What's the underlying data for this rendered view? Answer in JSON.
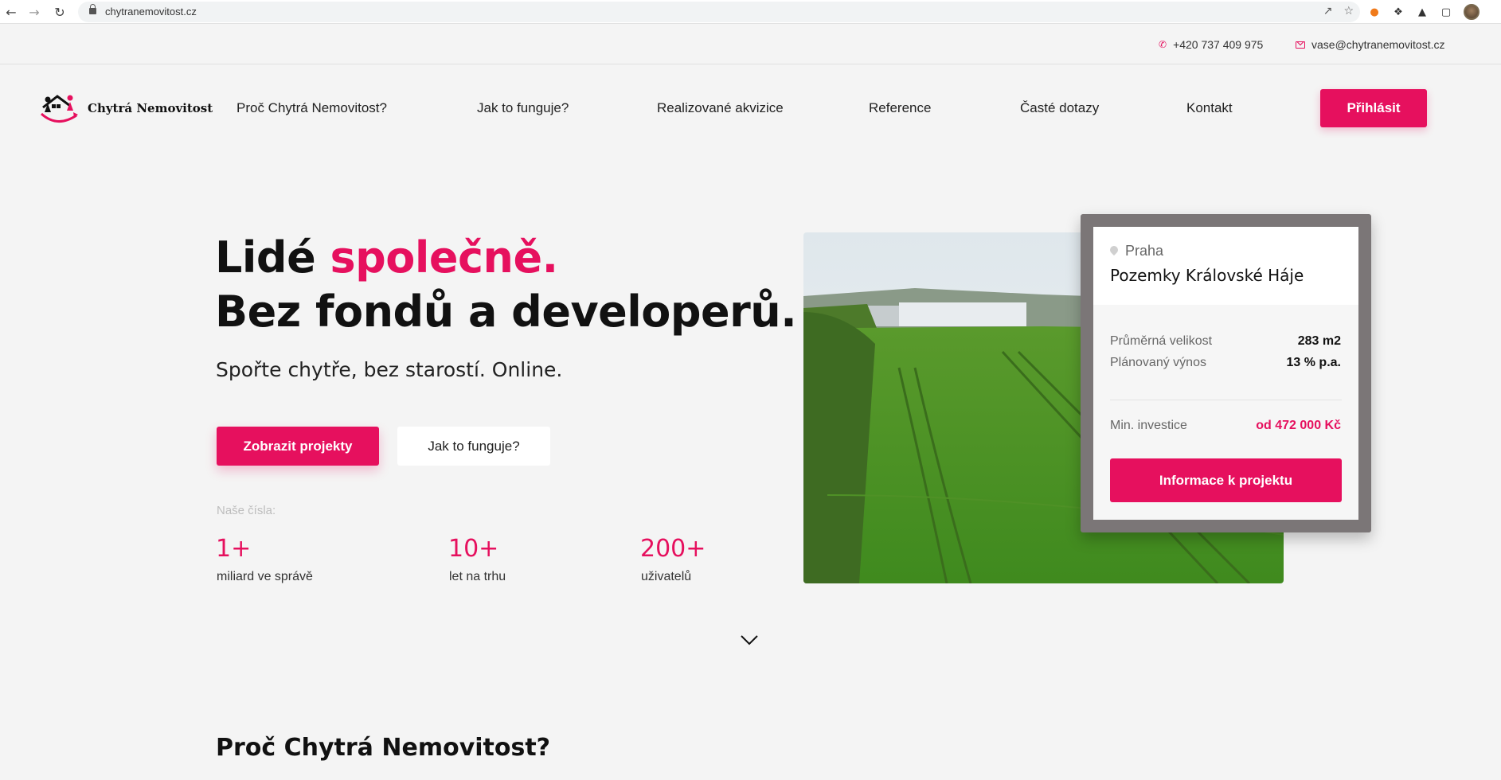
{
  "browser": {
    "url": "chytranemovitost.cz"
  },
  "contact": {
    "phone": "+420 737 409 975",
    "email": "vase@chytranemovitost.cz"
  },
  "header": {
    "logo_text": "Chytrá Nemovitost",
    "nav": [
      "Proč Chytrá Nemovitost?",
      "Jak to funguje?",
      "Realizované akvizice",
      "Reference",
      "Časté dotazy",
      "Kontakt"
    ],
    "login_label": "Přihlásit"
  },
  "hero": {
    "title_part1": "Lidé ",
    "title_highlight": "společně.",
    "title_line2": "Bez fondů a developerů.",
    "subtitle": "Spořte chytře, bez starostí. Online.",
    "primary_button": "Zobrazit projekty",
    "secondary_button": "Jak to funguje?",
    "stats_label": "Naše čísla:",
    "stats": [
      {
        "value": "1+",
        "caption": "miliard ve správě"
      },
      {
        "value": "10+",
        "caption": "let na trhu"
      },
      {
        "value": "200+",
        "caption": "uživatelů"
      }
    ]
  },
  "project_card": {
    "city": "Praha",
    "name": "Pozemky Královské Háje",
    "rows": [
      {
        "label": "Průměrná velikost",
        "value": "283 m2"
      },
      {
        "label": "Plánovaný výnos",
        "value": "13 % p.a."
      }
    ],
    "min_label": "Min. investice",
    "min_value": "od 472 000 Kč",
    "button": "Informace k projektu"
  },
  "section": {
    "title": "Proč Chytrá Nemovitost?"
  },
  "colors": {
    "accent": "#e6105e",
    "background": "#f4f4f4"
  }
}
